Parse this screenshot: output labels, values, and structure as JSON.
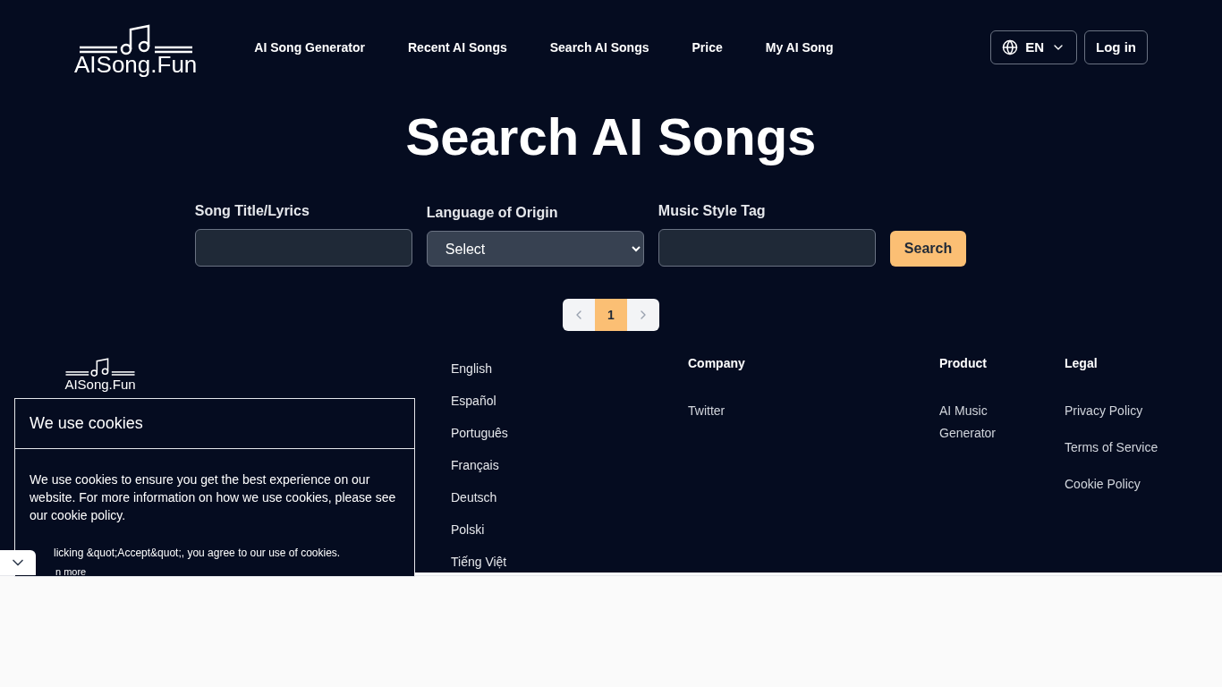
{
  "header": {
    "logo": "AISong.Fun",
    "nav": [
      "AI Song Generator",
      "Recent AI Songs",
      "Search AI Songs",
      "Price",
      "My AI Song"
    ],
    "language": "EN",
    "login": "Log in"
  },
  "title": "Search AI Songs",
  "form": {
    "fields": [
      {
        "kind": "text",
        "label": "Song Title/Lyrics"
      },
      {
        "kind": "select",
        "label": "Language of Origin",
        "value": "Select"
      },
      {
        "kind": "text",
        "label": "Music Style Tag"
      }
    ],
    "button": "Search"
  },
  "pagination": {
    "pages": [
      {
        "label": "1",
        "selected": true
      }
    ]
  },
  "footer": {
    "logo": "AISong.Fun",
    "languages": [
      "English",
      "Español",
      "Português",
      "Français",
      "Deutsch",
      "Polski",
      "Tiếng Việt"
    ],
    "columns": [
      {
        "title": "Company",
        "links": [
          "Twitter"
        ]
      },
      {
        "title": "Product",
        "links": [
          "AI Music Generator"
        ]
      },
      {
        "title": "Legal",
        "links": [
          "Privacy Policy",
          "Terms of Service",
          "Cookie Policy"
        ]
      }
    ]
  },
  "cookie_banner": {
    "title": "We use cookies",
    "text": "We use cookies to ensure you get the best experience on our website. For more information on how we use cookies, please see our cookie policy.",
    "consent": "licking &quot;Accept&quot;, you agree to our use of cookies.",
    "link": "n more"
  }
}
